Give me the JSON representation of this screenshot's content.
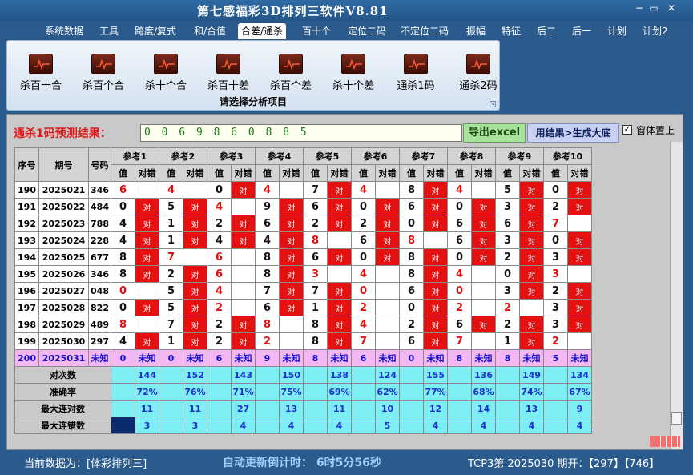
{
  "app": {
    "title": "第七感福彩3D排列三软件V8.81"
  },
  "window": {
    "minimize": "−",
    "restore": "▭",
    "close": "✕"
  },
  "menu": [
    "系统数据",
    "工具",
    "跨度/复式",
    "和/合值",
    "合差/通杀",
    "百十个",
    "定位二码",
    "不定位二码",
    "振幅",
    "特征",
    "后二",
    "后一",
    "计划",
    "计划2"
  ],
  "ribbon": {
    "buttons": [
      "杀百十合",
      "杀百个合",
      "杀十个合",
      "杀百十差",
      "杀百个差",
      "杀十个差",
      "通杀1码",
      "通杀2码"
    ],
    "caption": "请选择分析项目",
    "icon": "chart-icon"
  },
  "prediction": {
    "label": "通杀1码预测结果：",
    "value": "0 0 6 9 8 6 0 8 8 5"
  },
  "buttons": {
    "export": "导出excel",
    "generate": "用结果>生成大底",
    "on_top": "窗体置上",
    "on_top_checked": "✓"
  },
  "table": {
    "headers": {
      "row_no": "序号",
      "period": "期号",
      "number": "号码",
      "ref": [
        "参考1",
        "参考2",
        "参考3",
        "参考4",
        "参考5",
        "参考6",
        "参考7",
        "参考8",
        "参考9",
        "参考10"
      ],
      "value": "值",
      "hit": "对错"
    },
    "hit_text": "对",
    "rows": [
      {
        "no": "190",
        "period": "2025021",
        "num": "346",
        "refs": [
          [
            "6",
            0
          ],
          [
            "4",
            0
          ],
          [
            "0",
            1
          ],
          [
            "4",
            0
          ],
          [
            "7",
            1
          ],
          [
            "4",
            0
          ],
          [
            "8",
            1
          ],
          [
            "4",
            0
          ],
          [
            "5",
            1
          ],
          [
            "0",
            1
          ]
        ]
      },
      {
        "no": "191",
        "period": "2025022",
        "num": "484",
        "refs": [
          [
            "0",
            1
          ],
          [
            "5",
            1
          ],
          [
            "4",
            0
          ],
          [
            "9",
            1
          ],
          [
            "6",
            1
          ],
          [
            "0",
            1
          ],
          [
            "6",
            1
          ],
          [
            "0",
            1
          ],
          [
            "3",
            1
          ],
          [
            "2",
            1
          ]
        ]
      },
      {
        "no": "192",
        "period": "2025023",
        "num": "788",
        "refs": [
          [
            "4",
            1
          ],
          [
            "1",
            1
          ],
          [
            "2",
            1
          ],
          [
            "6",
            1
          ],
          [
            "2",
            1
          ],
          [
            "2",
            1
          ],
          [
            "0",
            1
          ],
          [
            "6",
            1
          ],
          [
            "6",
            1
          ],
          [
            "7",
            0
          ]
        ]
      },
      {
        "no": "193",
        "period": "2025024",
        "num": "228",
        "refs": [
          [
            "4",
            1
          ],
          [
            "1",
            1
          ],
          [
            "4",
            1
          ],
          [
            "4",
            1
          ],
          [
            "8",
            0
          ],
          [
            "6",
            1
          ],
          [
            "8",
            0
          ],
          [
            "6",
            1
          ],
          [
            "3",
            1
          ],
          [
            "0",
            1
          ]
        ]
      },
      {
        "no": "194",
        "period": "2025025",
        "num": "677",
        "refs": [
          [
            "8",
            1
          ],
          [
            "7",
            0
          ],
          [
            "6",
            0
          ],
          [
            "8",
            1
          ],
          [
            "6",
            1
          ],
          [
            "0",
            1
          ],
          [
            "8",
            1
          ],
          [
            "0",
            1
          ],
          [
            "2",
            1
          ],
          [
            "3",
            1
          ]
        ]
      },
      {
        "no": "195",
        "period": "2025026",
        "num": "346",
        "refs": [
          [
            "8",
            1
          ],
          [
            "2",
            1
          ],
          [
            "6",
            0
          ],
          [
            "8",
            1
          ],
          [
            "3",
            0
          ],
          [
            "4",
            0
          ],
          [
            "8",
            1
          ],
          [
            "4",
            0
          ],
          [
            "0",
            1
          ],
          [
            "3",
            0
          ]
        ]
      },
      {
        "no": "196",
        "period": "2025027",
        "num": "048",
        "refs": [
          [
            "0",
            0
          ],
          [
            "5",
            1
          ],
          [
            "4",
            0
          ],
          [
            "7",
            1
          ],
          [
            "7",
            1
          ],
          [
            "0",
            0
          ],
          [
            "6",
            1
          ],
          [
            "0",
            0
          ],
          [
            "3",
            1
          ],
          [
            "2",
            1
          ]
        ]
      },
      {
        "no": "197",
        "period": "2025028",
        "num": "822",
        "refs": [
          [
            "0",
            1
          ],
          [
            "5",
            1
          ],
          [
            "2",
            0
          ],
          [
            "6",
            1
          ],
          [
            "1",
            1
          ],
          [
            "2",
            0
          ],
          [
            "0",
            1
          ],
          [
            "2",
            0
          ],
          [
            "2",
            0
          ],
          [
            "3",
            1
          ]
        ]
      },
      {
        "no": "198",
        "period": "2025029",
        "num": "489",
        "refs": [
          [
            "8",
            0
          ],
          [
            "7",
            1
          ],
          [
            "2",
            1
          ],
          [
            "8",
            0
          ],
          [
            "8",
            1
          ],
          [
            "4",
            0
          ],
          [
            "2",
            1
          ],
          [
            "6",
            1
          ],
          [
            "2",
            1
          ],
          [
            "3",
            1
          ]
        ]
      },
      {
        "no": "199",
        "period": "2025030",
        "num": "297",
        "refs": [
          [
            "4",
            1
          ],
          [
            "1",
            1
          ],
          [
            "2",
            1
          ],
          [
            "2",
            0
          ],
          [
            "8",
            1
          ],
          [
            "7",
            0
          ],
          [
            "6",
            1
          ],
          [
            "7",
            0
          ],
          [
            "1",
            1
          ],
          [
            "2",
            0
          ]
        ]
      }
    ],
    "last_row": {
      "no": "200",
      "period": "2025031",
      "num": "未知",
      "vals": [
        "0",
        "0",
        "6",
        "9",
        "8",
        "6",
        "0",
        "8",
        "8",
        "5"
      ],
      "unknown": "未知"
    },
    "stats": [
      {
        "label": "对次数",
        "vals": [
          "144",
          "152",
          "143",
          "150",
          "138",
          "124",
          "155",
          "136",
          "149",
          "134"
        ]
      },
      {
        "label": "准确率",
        "vals": [
          "72%",
          "76%",
          "71%",
          "75%",
          "69%",
          "62%",
          "77%",
          "68%",
          "74%",
          "67%"
        ]
      },
      {
        "label": "最大连对数",
        "vals": [
          "11",
          "11",
          "27",
          "13",
          "11",
          "10",
          "12",
          "14",
          "13",
          "9"
        ]
      },
      {
        "label": "最大连错数",
        "vals": [
          "3",
          "3",
          "4",
          "4",
          "4",
          "5",
          "4",
          "4",
          "4",
          "4"
        ]
      }
    ]
  },
  "status": {
    "data": "当前数据为：[体彩排列三]",
    "countdown": "自动更新倒计时：  6时5分56秒",
    "issue": "TCP3第 2025030 期开：【297】【746】"
  },
  "colors": {
    "hit": "#e51010",
    "pending_row": "#f4b7f4",
    "stats": "#7deef4",
    "window": "#2b5a8c"
  }
}
